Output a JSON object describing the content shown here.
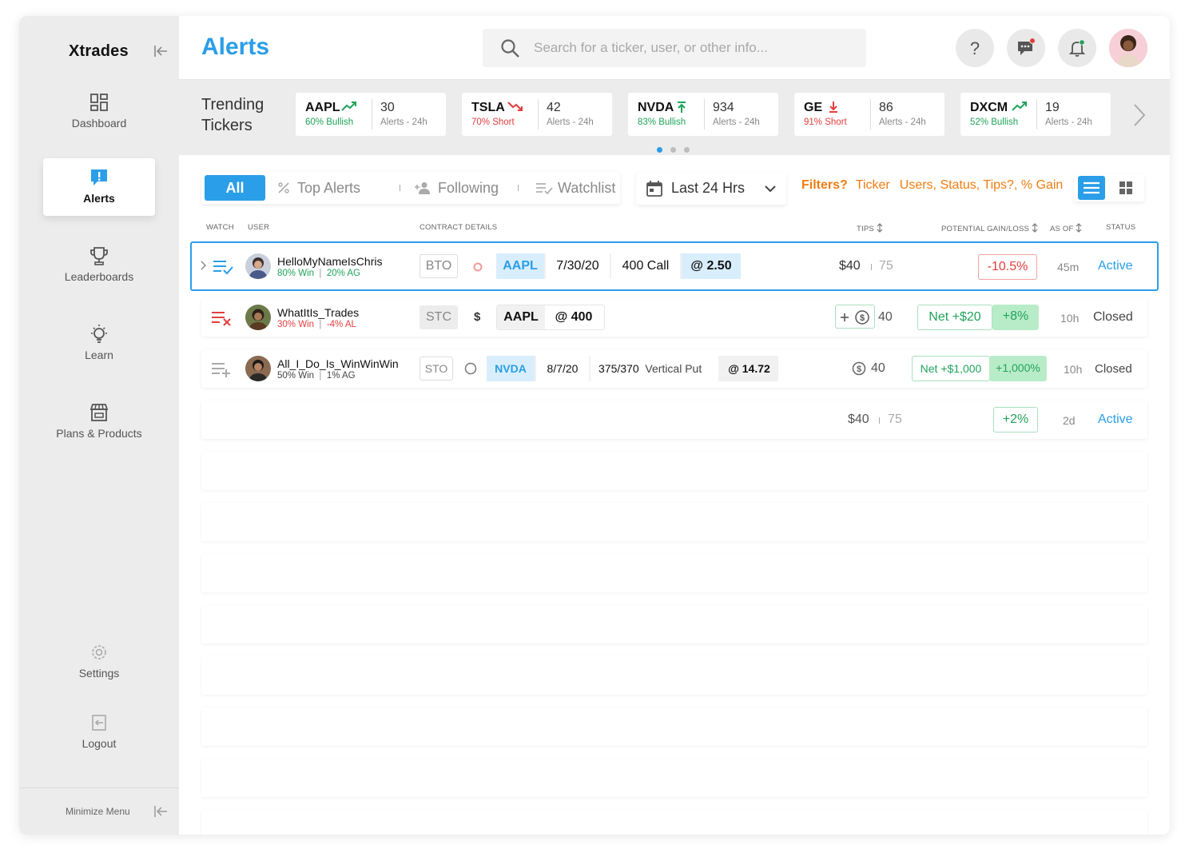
{
  "app": {
    "brand": "Xtrades"
  },
  "sidebar": {
    "items": [
      {
        "label": "Dashboard",
        "icon": "dashboard-icon"
      },
      {
        "label": "Alerts",
        "icon": "alert-icon"
      },
      {
        "label": "Leaderboards",
        "icon": "trophy-icon"
      },
      {
        "label": "Learn",
        "icon": "lightbulb-icon"
      },
      {
        "label": "Plans & Products",
        "icon": "store-icon"
      },
      {
        "label": "Settings",
        "icon": "gear-icon"
      },
      {
        "label": "Logout",
        "icon": "logout-icon"
      }
    ],
    "minimize_label": "Minimize Menu"
  },
  "header": {
    "title": "Alerts",
    "search_placeholder": "Search for a ticker, user, or other info...",
    "help_label": "?"
  },
  "trending": {
    "title": "Trending Tickers",
    "cards": [
      {
        "symbol": "AAPL",
        "sentiment": "60% Bullish",
        "trend": "up",
        "count": "30",
        "sub": "Alerts - 24h"
      },
      {
        "symbol": "TSLA",
        "sentiment": "70% Short",
        "trend": "down",
        "count": "42",
        "sub": "Alerts - 24h"
      },
      {
        "symbol": "NVDA",
        "sentiment": "83% Bullish",
        "trend": "up-arrow",
        "count": "934",
        "sub": "Alerts - 24h"
      },
      {
        "symbol": "GE",
        "sentiment": "91% Short",
        "trend": "down-arrow",
        "count": "86",
        "sub": "Alerts - 24h"
      },
      {
        "symbol": "DXCM",
        "sentiment": "52% Bullish",
        "trend": "up",
        "count": "19",
        "sub": "Alerts - 24h"
      }
    ]
  },
  "filters": {
    "tabs": [
      "All",
      "Top Alerts",
      "Following",
      "Watchlist"
    ],
    "range": "Last 24 Hrs",
    "filters_label": "Filters?",
    "ticker_link": "Ticker",
    "more_link": "Users, Status, Tips?, % Gain"
  },
  "table": {
    "headers": {
      "watch": "WATCH",
      "user": "USER",
      "contract": "CONTRACT DETAILS",
      "tips": "TIPS",
      "gain": "POTENTIAL GAIN/LOSS",
      "asof": "AS OF",
      "status": "STATUS"
    },
    "rows": [
      {
        "user": "HelloMyNameIsChris",
        "win": "80% Win",
        "ag": "20% AG",
        "action": "BTO",
        "symbol": "AAPL",
        "date": "7/30/20",
        "strike": "400 Call",
        "price": "@ 2.50",
        "tips": "$40",
        "tips_count": "75",
        "gain": "-10.5%",
        "asof": "45m",
        "status": "Active"
      },
      {
        "user": "WhatItIs_Trades",
        "win": "30% Win",
        "ag": "-4% AL",
        "action": "STC",
        "symbol": "AAPL",
        "price": "@ 400",
        "dollar": "$",
        "tips_count": "40",
        "net": "Net +$20",
        "gain": "+8%",
        "asof": "10h",
        "status": "Closed"
      },
      {
        "user": "All_I_Do_Is_WinWinWin",
        "win": "50% Win",
        "ag": "1% AG",
        "action": "STO",
        "symbol": "NVDA",
        "date": "8/7/20",
        "strike": "375/370",
        "type": "Vertical Put",
        "price": "@ 14.72",
        "tips_count": "40",
        "net": "Net +$1,000",
        "gain": "+1,000%",
        "asof": "10h",
        "status": "Closed"
      },
      {
        "tips": "$40",
        "tips_count": "75",
        "gain": "+2%",
        "asof": "2d",
        "status": "Active"
      }
    ]
  },
  "colors": {
    "accent": "#2a9ee8",
    "positive": "#20a35b",
    "negative": "#e43d3d",
    "filter": "#f07c12"
  }
}
